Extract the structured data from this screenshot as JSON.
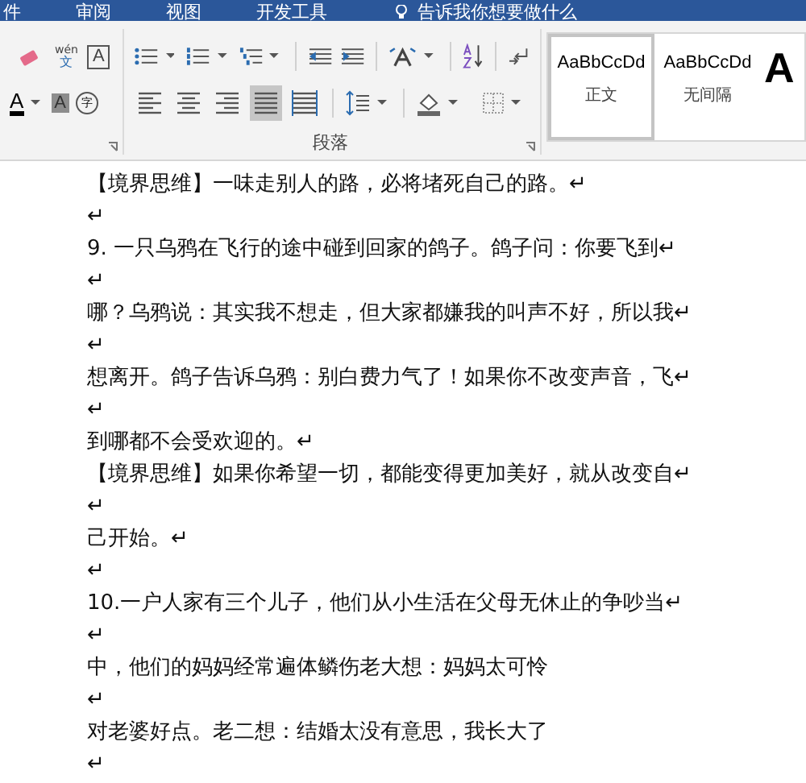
{
  "menu_tabs": [
    "件",
    "审阅",
    "视图",
    "开发工具"
  ],
  "tell_me": "告诉我你想要做什么",
  "font_group": {
    "phonetic_top": "wén",
    "phonetic_bottom": "文",
    "border_letter": "A",
    "font_color_letter": "A",
    "shading_letter": "A",
    "enclose_char": "字"
  },
  "paragraph_group": {
    "label": "段落",
    "alignment_buttons": [
      {
        "kind": "left",
        "selected": false
      },
      {
        "kind": "center",
        "selected": false
      },
      {
        "kind": "right",
        "selected": false
      },
      {
        "kind": "justify",
        "selected": true
      },
      {
        "kind": "distributed",
        "selected": false
      }
    ]
  },
  "styles": [
    {
      "preview": "AaBbCcDd",
      "name": "正文",
      "selected": true
    },
    {
      "preview": "AaBbCcDd",
      "name": "无间隔",
      "selected": false
    },
    {
      "preview": "A",
      "selected": false
    }
  ],
  "document_lines": [
    "【境界思维】一味走别人的路，必将堵死自己的路。↵",
    "↵",
    "9.   一只乌鸦在飞行的途中碰到回家的鸽子。鸽子问：你要飞到↵",
    "↵",
    "哪？乌鸦说：其实我不想走，但大家都嫌我的叫声不好，所以我↵",
    "↵",
    "想离开。鸽子告诉乌鸦：别白费力气了！如果你不改变声音，飞↵",
    "↵",
    "到哪都不会受欢迎的。↵",
    "【境界思维】如果你希望一切，都能变得更加美好，就从改变自↵",
    "↵",
    "己开始。↵",
    "↵",
    "10.一户人家有三个儿子，他们从小生活在父母无休止的争吵当↵",
    "↵",
    "中，他们的妈妈经常遍体鳞伤老大想：妈妈太可怜",
    "↵",
    "对老婆好点。老二想：结婚太没有意思，我长大了",
    "↵"
  ]
}
